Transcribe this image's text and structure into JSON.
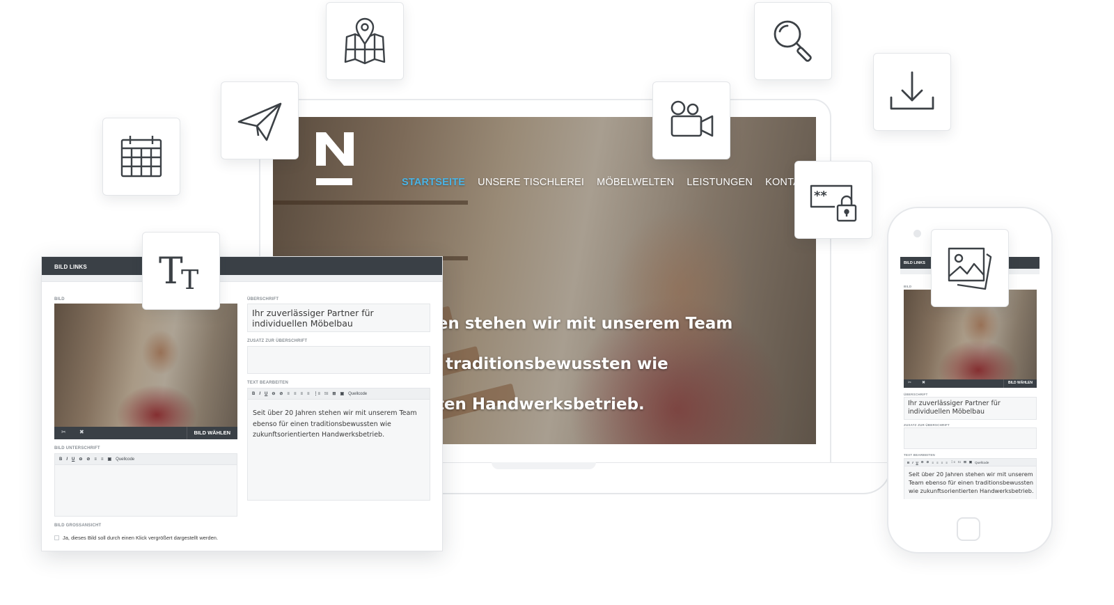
{
  "website": {
    "logo_letter": "N",
    "nav": [
      {
        "label": "STARTSEITE",
        "active": true
      },
      {
        "label": "UNSERE TISCHLEREI",
        "active": false
      },
      {
        "label": "MÖBELWELTEN",
        "active": false
      },
      {
        "label": "LEISTUNGEN",
        "active": false
      },
      {
        "label": "KONTAKT",
        "active": false
      }
    ],
    "hero_lines": [
      "hren stehen wir mit unserem Team",
      "en traditionsbewussten wie",
      "erten Handwerksbetrieb."
    ],
    "accent_color": "#49b4e6"
  },
  "icon_tiles": [
    "calendar-icon",
    "paper-plane-icon",
    "map-pin-icon",
    "video-camera-icon",
    "search-icon",
    "download-icon",
    "password-lock-icon",
    "text-size-icon",
    "image-gallery-icon"
  ],
  "cms": {
    "panel_title": "BILD LINKS",
    "image_label": "BILD",
    "choose_image": "BILD WÄHLEN",
    "caption_label": "BILD UNTERSCHRIFT",
    "enlarge_label": "BILD GROSSANSICHT",
    "enlarge_checkbox": "Ja, dieses Bild soll durch einen Klick vergrößert dargestellt werden.",
    "heading_label": "ÜBERSCHRIFT",
    "heading_value": "Ihr zuverlässiger Partner für individuellen Möbelbau",
    "subheading_label": "ZUSATZ ZUR ÜBERSCHRIFT",
    "text_label": "TEXT BEARBEITEN",
    "body_text": "Seit über 20 Jahren stehen wir mit unserem Team ebenso für einen traditionsbewussten wie zukunftsorientierten Handwerksbetrieb.",
    "toolbar_full": [
      "B",
      "I",
      "U",
      "⊖",
      "⊘",
      "≡",
      "≡",
      "≡",
      "≡",
      "⋮≡",
      "⁝≡",
      "⊞",
      "▣"
    ],
    "toolbar_small": [
      "B",
      "I",
      "U",
      "⊖",
      "⊘",
      "≡",
      "≡",
      "▣"
    ],
    "source_label": "Quellcode"
  },
  "phone": {
    "panel_title": "BILD LINKS",
    "image_label": "BILD",
    "choose_image": "BILD WÄHLEN",
    "heading_label": "ÜBERSCHRIFT",
    "heading_value": "Ihr zuverlässiger Partner für individuellen Möbelbau",
    "subheading_label": "ZUSATZ ZUR ÜBERSCHRIFT",
    "text_label": "TEXT BEARBEITEN",
    "body_text": "Seit über 20 Jahren stehen wir mit unserem Team ebenso für einen traditionsbewussten wie zukunftsorientierten Handwerksbetrieb.",
    "source_label": "Quellcode"
  }
}
